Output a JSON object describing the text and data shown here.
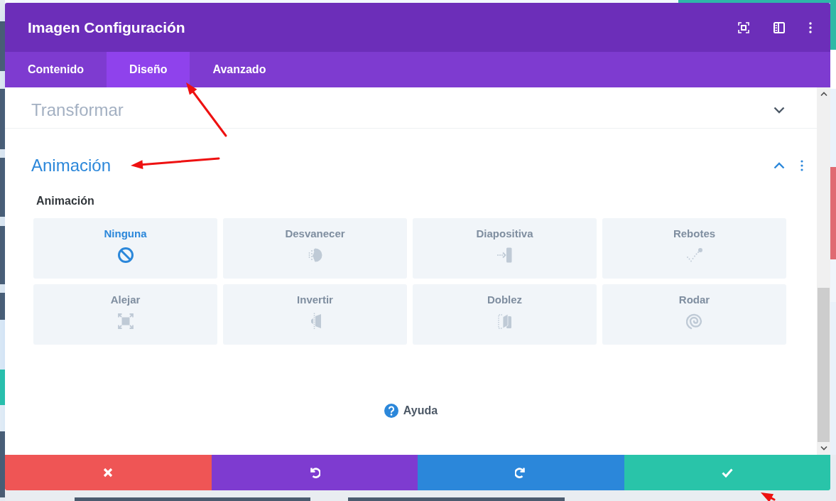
{
  "modal": {
    "title": "Imagen Configuración",
    "tabs": [
      {
        "label": "Contenido",
        "selected": false
      },
      {
        "label": "Diseño",
        "selected": true
      },
      {
        "label": "Avanzado",
        "selected": false
      }
    ]
  },
  "sections": [
    {
      "title": "Transformar",
      "expanded": false
    },
    {
      "title": "Animación",
      "expanded": true,
      "field_label": "Animación",
      "options": [
        {
          "label": "Ninguna",
          "kind": "none",
          "selected": true
        },
        {
          "label": "Desvanecer",
          "kind": "fade",
          "selected": false
        },
        {
          "label": "Diapositiva",
          "kind": "slide",
          "selected": false
        },
        {
          "label": "Rebotes",
          "kind": "bounce",
          "selected": false
        },
        {
          "label": "Alejar",
          "kind": "zoom",
          "selected": false
        },
        {
          "label": "Invertir",
          "kind": "flip",
          "selected": false
        },
        {
          "label": "Doblez",
          "kind": "fold",
          "selected": false
        },
        {
          "label": "Rodar",
          "kind": "roll",
          "selected": false
        }
      ]
    }
  ],
  "help": {
    "label": "Ayuda"
  },
  "footer_buttons": [
    {
      "kind": "cancel"
    },
    {
      "kind": "undo"
    },
    {
      "kind": "redo"
    },
    {
      "kind": "save"
    }
  ]
}
